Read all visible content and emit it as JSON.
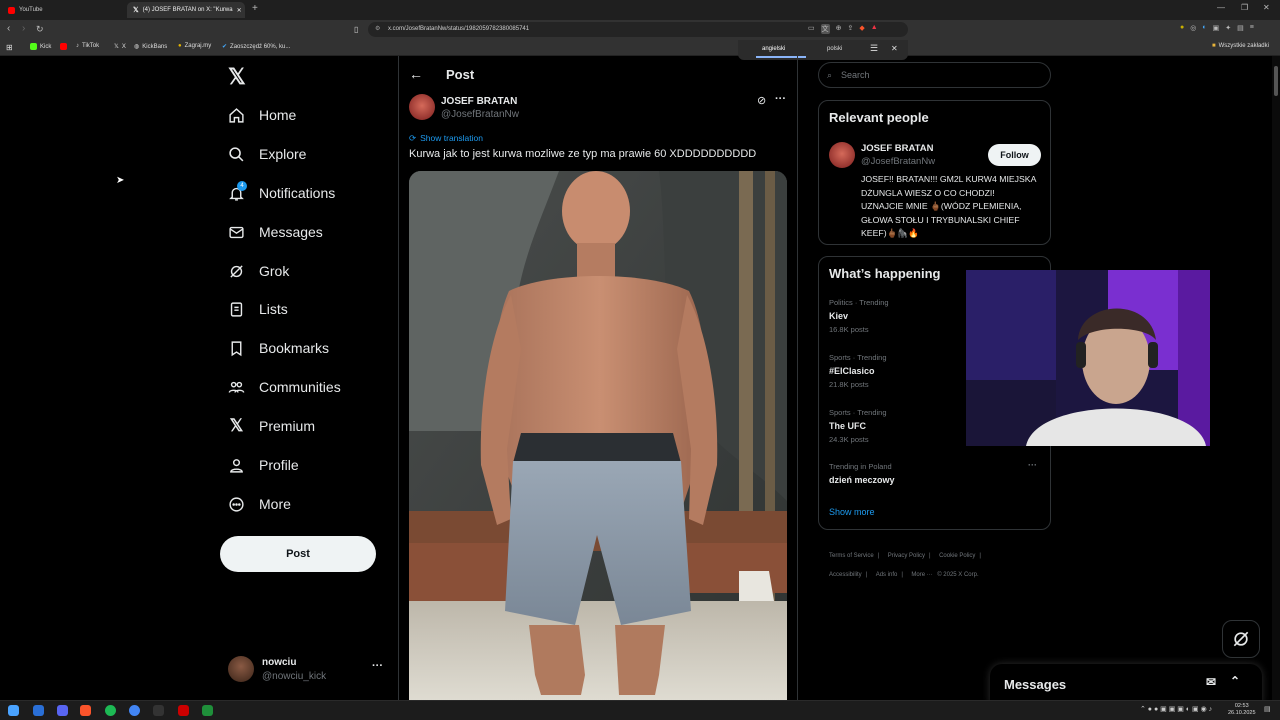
{
  "browser": {
    "tabs": [
      {
        "title": "YouTube"
      },
      {
        "title": "(4) JOSEF BRATAN on X: \"Kurwa"
      }
    ],
    "url": "x.com/JosefBratanNw/status/1982059782380085741",
    "bookmarks": [
      "Kick",
      "TikTok",
      "X",
      "KickBans",
      "Zagraj.my",
      "Zaoszczędź 60%, ku..."
    ],
    "bookmarks_right": "Wszystkie zakładki",
    "translate_popup": {
      "from": "angielski",
      "to": "polski"
    }
  },
  "nav": {
    "items": [
      {
        "label": "Home",
        "icon": "home-icon"
      },
      {
        "label": "Explore",
        "icon": "search-icon"
      },
      {
        "label": "Notifications",
        "icon": "bell-icon",
        "badge": "4"
      },
      {
        "label": "Messages",
        "icon": "envelope-icon"
      },
      {
        "label": "Grok",
        "icon": "grok-icon"
      },
      {
        "label": "Lists",
        "icon": "list-icon"
      },
      {
        "label": "Bookmarks",
        "icon": "bookmark-icon"
      },
      {
        "label": "Communities",
        "icon": "communities-icon"
      },
      {
        "label": "Premium",
        "icon": "x-logo-icon"
      },
      {
        "label": "Profile",
        "icon": "person-icon"
      },
      {
        "label": "More",
        "icon": "more-circle-icon"
      }
    ],
    "post_label": "Post",
    "account": {
      "name": "nowciu",
      "handle": "@nowciu_kick"
    }
  },
  "post": {
    "header": "Post",
    "author_name": "JOSEF BRATAN",
    "author_handle": "@JosefBratanNw",
    "show_translation": "Show translation",
    "text": "Kurwa jak to jest kurwa mozliwe ze typ ma prawie 60 XDDDDDDDDDD"
  },
  "sidebar": {
    "search_placeholder": "Search",
    "relevant": {
      "title": "Relevant people",
      "name": "JOSEF BRATAN",
      "handle": "@JosefBratanNw",
      "follow": "Follow",
      "bio": "JOSEF!! BRATAN!!! GM2L KURW4 MIEJSKA DŻUNGLA WIESZ O CO CHODZI! UZNAJCIE MNIE 🖕🏾(WÓDZ PLEMIENIA, GŁOWA STOŁU I TRYBUNALSKI CHIEF KEEF)🖕🏾🦍🔥"
    },
    "happening": {
      "title": "What’s happening",
      "trends": [
        {
          "meta": "Politics · Trending",
          "title": "Kiev",
          "count": "16.8K posts"
        },
        {
          "meta": "Sports · Trending",
          "title": "#ElClasico",
          "count": "21.8K posts"
        },
        {
          "meta": "Sports · Trending",
          "title": "The UFC",
          "count": "24.3K posts"
        },
        {
          "meta": "Trending in Poland",
          "title": "dzień meczowy",
          "count": ""
        }
      ],
      "show_more": "Show more"
    },
    "footer": [
      "Terms of Service",
      "Privacy Policy",
      "Cookie Policy",
      "Accessibility",
      "Ads info",
      "More ···",
      "© 2025 X Corp."
    ]
  },
  "messages_drawer": {
    "title": "Messages"
  },
  "taskbar": {
    "time": "02:53",
    "date": "26.10.2025"
  },
  "colors": {
    "accent": "#1d9bf0",
    "background": "#000000",
    "border": "#2f3336",
    "muted": "#71767b"
  }
}
